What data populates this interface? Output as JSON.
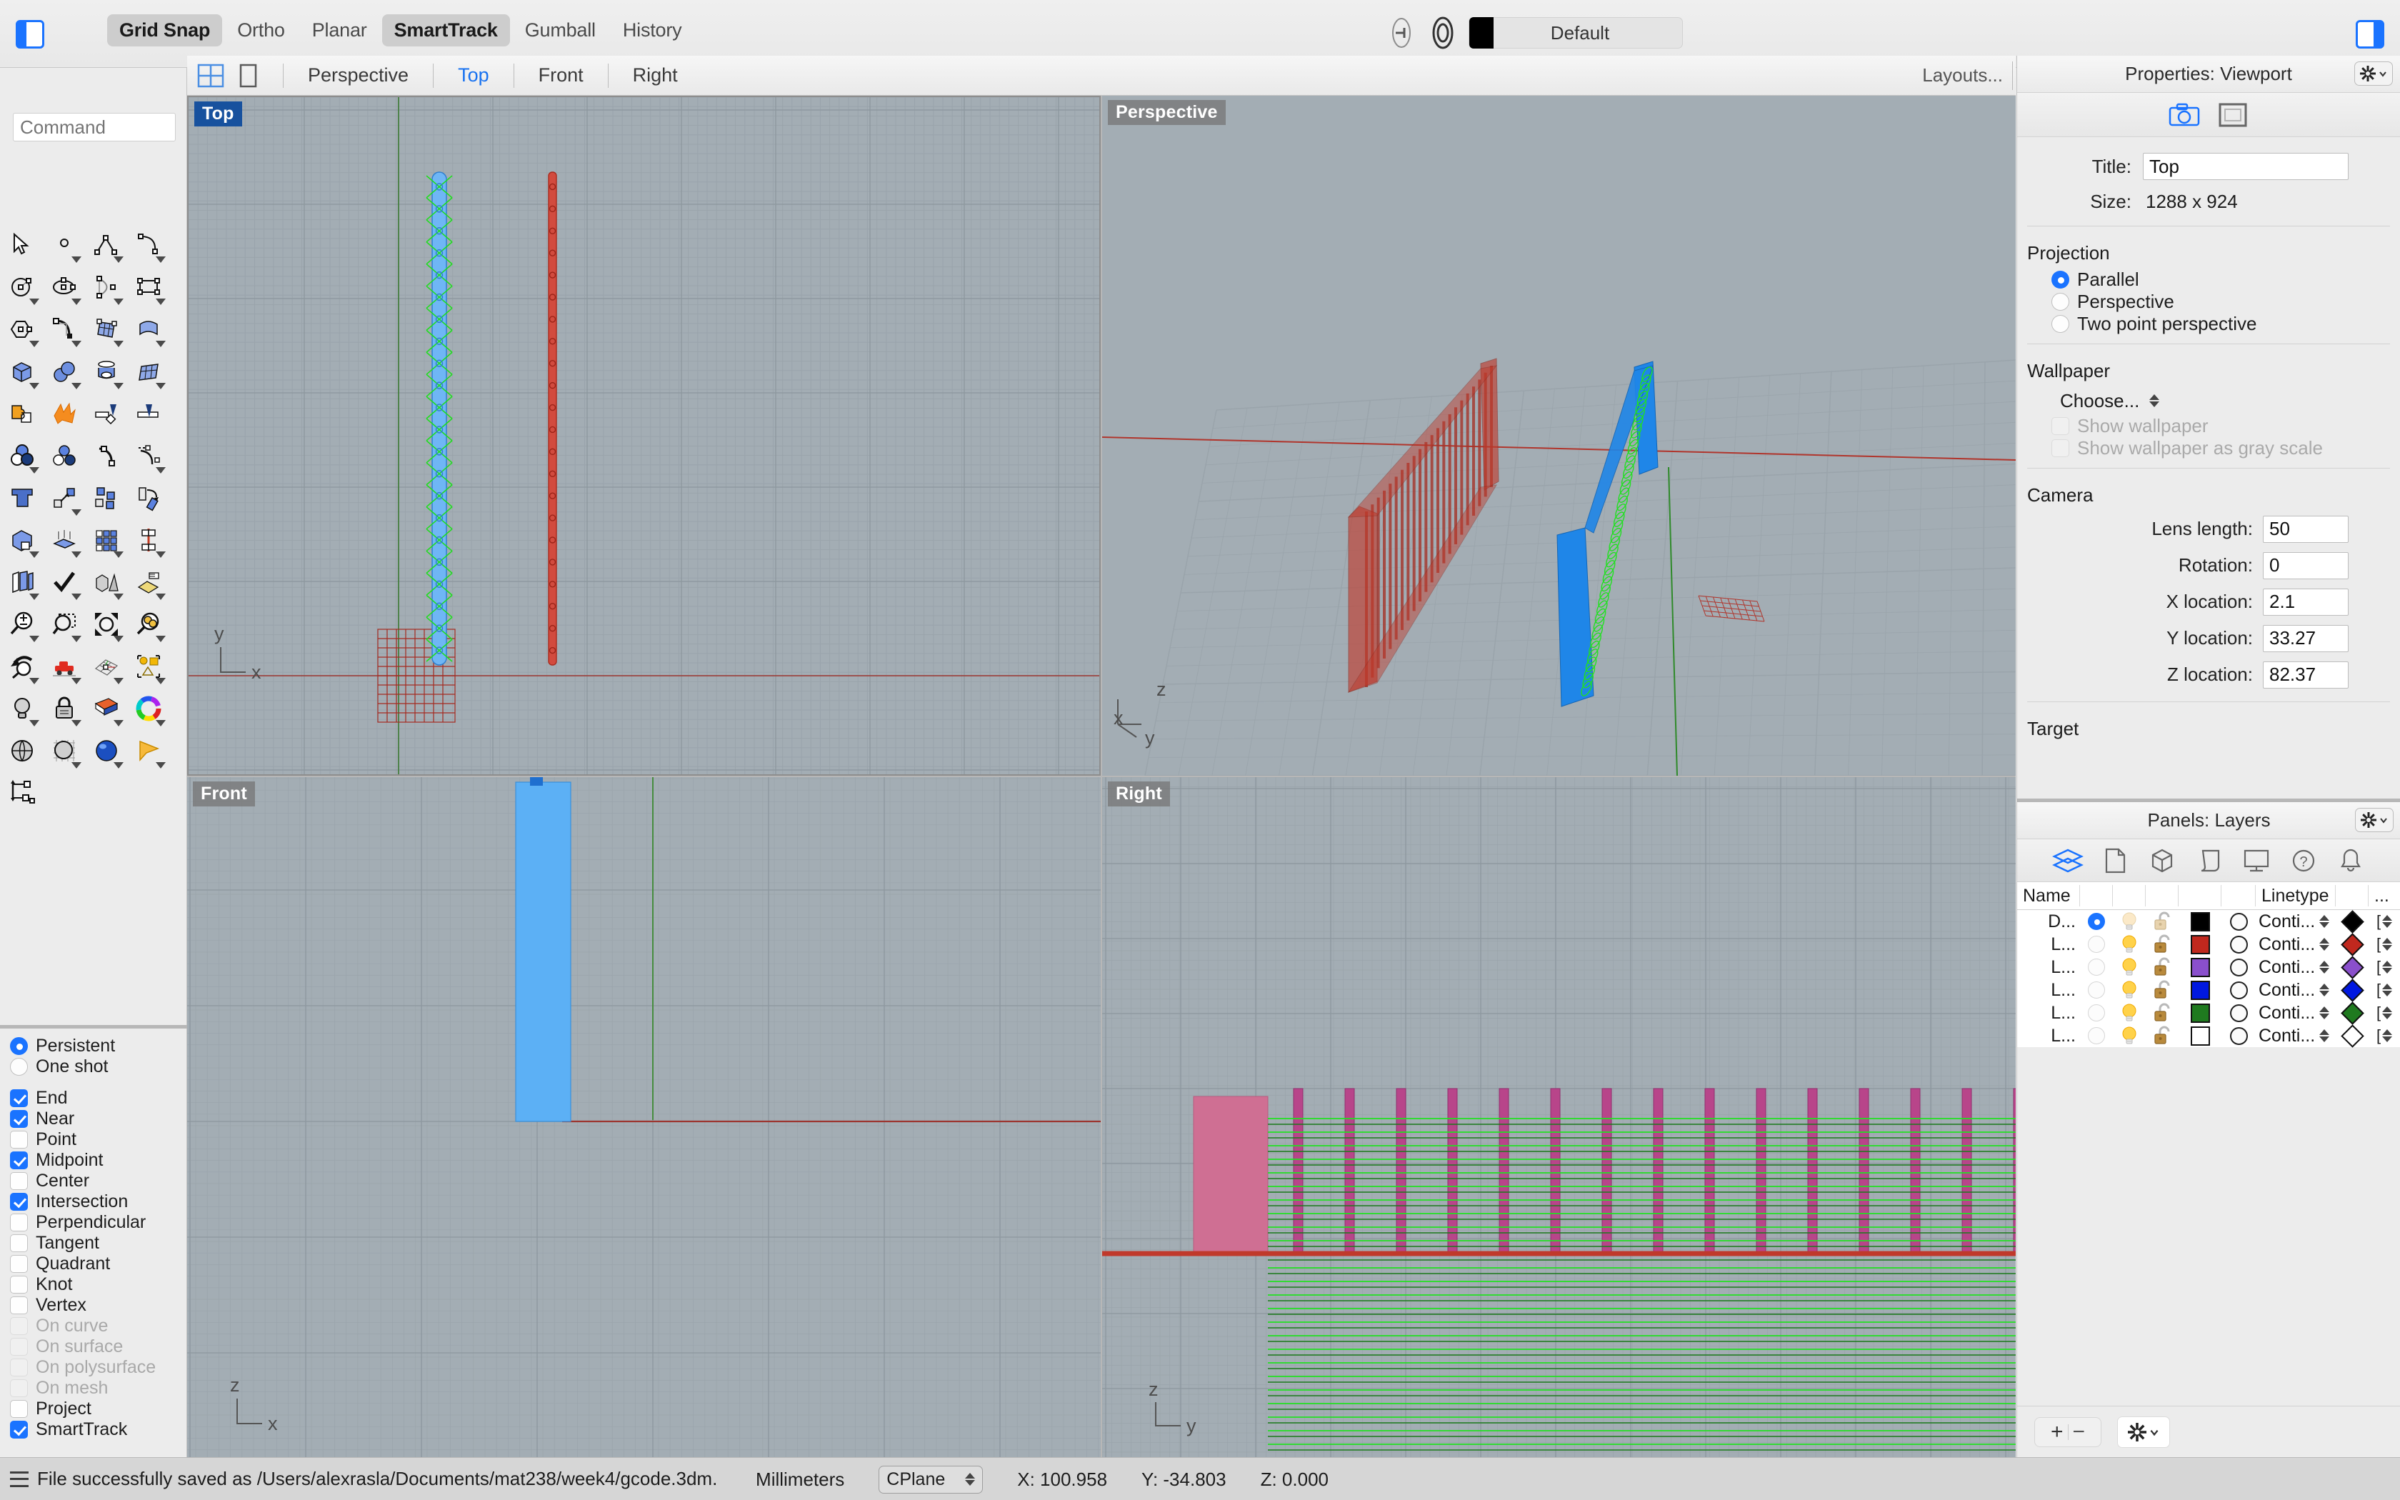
{
  "topbar": {
    "left_panel_toggle": "left-panel-toggle",
    "right_panel_toggle": "right-panel-toggle",
    "modes": [
      {
        "label": "Grid Snap",
        "active": true
      },
      {
        "label": "Ortho",
        "active": false
      },
      {
        "label": "Planar",
        "active": false
      },
      {
        "label": "SmartTrack",
        "active": true
      },
      {
        "label": "Gumball",
        "active": false
      },
      {
        "label": "History",
        "active": false
      }
    ],
    "layer_bar": {
      "color": "#000000",
      "label": "Default"
    }
  },
  "viewport_tabs": {
    "tabs": [
      {
        "label": "Perspective",
        "active": false
      },
      {
        "label": "Top",
        "active": true
      },
      {
        "label": "Front",
        "active": false
      },
      {
        "label": "Right",
        "active": false
      }
    ],
    "layouts_label": "Layouts..."
  },
  "command": {
    "placeholder": "Command",
    "value": ""
  },
  "snap": {
    "mode_options": [
      {
        "label": "Persistent",
        "selected": true
      },
      {
        "label": "One shot",
        "selected": false
      }
    ],
    "items": [
      {
        "label": "End",
        "checked": true,
        "enabled": true
      },
      {
        "label": "Near",
        "checked": true,
        "enabled": true
      },
      {
        "label": "Point",
        "checked": false,
        "enabled": true
      },
      {
        "label": "Midpoint",
        "checked": true,
        "enabled": true
      },
      {
        "label": "Center",
        "checked": false,
        "enabled": true
      },
      {
        "label": "Intersection",
        "checked": true,
        "enabled": true
      },
      {
        "label": "Perpendicular",
        "checked": false,
        "enabled": true
      },
      {
        "label": "Tangent",
        "checked": false,
        "enabled": true
      },
      {
        "label": "Quadrant",
        "checked": false,
        "enabled": true
      },
      {
        "label": "Knot",
        "checked": false,
        "enabled": true
      },
      {
        "label": "Vertex",
        "checked": false,
        "enabled": true
      },
      {
        "label": "On curve",
        "checked": false,
        "enabled": false
      },
      {
        "label": "On surface",
        "checked": false,
        "enabled": false
      },
      {
        "label": "On polysurface",
        "checked": false,
        "enabled": false
      },
      {
        "label": "On mesh",
        "checked": false,
        "enabled": false
      },
      {
        "label": "Project",
        "checked": false,
        "enabled": true
      },
      {
        "label": "SmartTrack",
        "checked": true,
        "enabled": true
      }
    ]
  },
  "viewports": [
    {
      "name": "Top",
      "label": "Top",
      "selected": true,
      "axes": [
        "y",
        "x"
      ]
    },
    {
      "name": "Perspective",
      "label": "Perspective",
      "selected": false,
      "axes": [
        "z",
        "x",
        "y"
      ]
    },
    {
      "name": "Front",
      "label": "Front",
      "selected": false,
      "axes": [
        "z",
        "x"
      ]
    },
    {
      "name": "Right",
      "label": "Right",
      "selected": false,
      "axes": [
        "z",
        "y"
      ]
    }
  ],
  "properties": {
    "title": "Properties: Viewport",
    "title_label": "Title:",
    "title_value": "Top",
    "size_label": "Size:",
    "size_value": "1288 x 924",
    "projection_heading": "Projection",
    "projection_options": [
      {
        "label": "Parallel",
        "selected": true
      },
      {
        "label": "Perspective",
        "selected": false
      },
      {
        "label": "Two point perspective",
        "selected": false
      }
    ],
    "wallpaper_heading": "Wallpaper",
    "wallpaper_choose": "Choose...",
    "wallpaper_checks": [
      {
        "label": "Show wallpaper",
        "checked": false,
        "enabled": false
      },
      {
        "label": "Show wallpaper as gray scale",
        "checked": false,
        "enabled": false
      }
    ],
    "camera_heading": "Camera",
    "camera_fields": [
      {
        "label": "Lens length:",
        "value": "50"
      },
      {
        "label": "Rotation:",
        "value": "0"
      },
      {
        "label": "X location:",
        "value": "2.1"
      },
      {
        "label": "Y location:",
        "value": "33.27"
      },
      {
        "label": "Z location:",
        "value": "82.37"
      }
    ],
    "target_heading": "Target"
  },
  "layers_panel": {
    "title": "Panels: Layers",
    "columns": [
      "Name",
      "",
      "",
      "",
      "",
      "",
      "Linetype",
      "",
      "..."
    ],
    "rows": [
      {
        "name": "D...",
        "current": true,
        "light": "on-dim",
        "locked": false,
        "color": "#000000",
        "print_color": "#fbfbfb",
        "linetype": "Conti...",
        "material": "#000000",
        "extra": "["
      },
      {
        "name": "L...",
        "current": false,
        "light": "on",
        "locked": false,
        "color": "#c0281e",
        "print_color": "#fbfbfb",
        "linetype": "Conti...",
        "material": "#c0281e",
        "extra": "["
      },
      {
        "name": "L...",
        "current": false,
        "light": "on",
        "locked": false,
        "color": "#8a4fcc",
        "print_color": "#fbfbfb",
        "linetype": "Conti...",
        "material": "#8a4fcc",
        "extra": "["
      },
      {
        "name": "L...",
        "current": false,
        "light": "on",
        "locked": false,
        "color": "#0018e0",
        "print_color": "#fbfbfb",
        "linetype": "Conti...",
        "material": "#0018e0",
        "extra": "["
      },
      {
        "name": "L...",
        "current": false,
        "light": "on",
        "locked": false,
        "color": "#1f7a1f",
        "print_color": "#fbfbfb",
        "linetype": "Conti...",
        "material": "#1f7a1f",
        "extra": "["
      },
      {
        "name": "L...",
        "current": false,
        "light": "on",
        "locked": false,
        "color": "#ffffff",
        "print_color": "#fbfbfb",
        "linetype": "Conti...",
        "material": "#ffffff",
        "extra": "["
      }
    ],
    "add_label": "+",
    "remove_label": "−"
  },
  "statusbar": {
    "message": "File successfully saved as /Users/alexrasla/Documents/mat238/week4/gcode.3dm.",
    "units": "Millimeters",
    "cplane": "CPlane",
    "x": "X: 100.958",
    "y": "Y: -34.803",
    "z": "Z: 0.000"
  },
  "colors": {
    "accent": "#1a73ff",
    "viewport_bg": "#a3adb4",
    "model_red": "#c0392b",
    "model_blue": "#3d9bf5",
    "model_green": "#22e022",
    "model_magenta": "#c0558c"
  }
}
